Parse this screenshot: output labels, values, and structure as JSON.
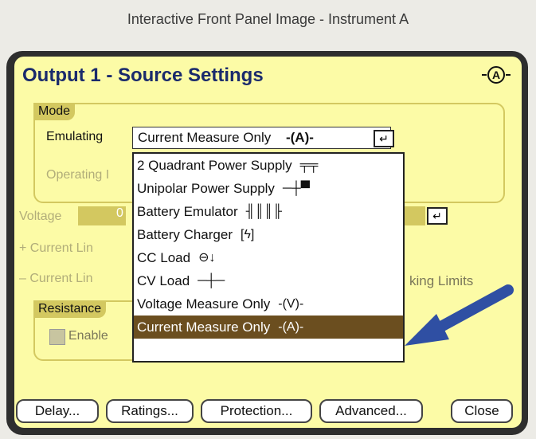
{
  "caption": "Interactive Front Panel Image - Instrument A",
  "panel": {
    "title": "Output 1 - Source Settings",
    "title_icon": "A"
  },
  "mode": {
    "group_label": "Mode",
    "emulating_label": "Emulating",
    "selected_value": "Current Measure Only",
    "selected_icon": "current-measure-icon",
    "operating_label": "Operating I"
  },
  "dropdown": {
    "options": [
      {
        "label": "2 Quadrant Power Supply",
        "icon": "two-quadrant-icon"
      },
      {
        "label": "Unipolar Power Supply",
        "icon": "unipolar-icon"
      },
      {
        "label": "Battery Emulator",
        "icon": "battery-emulator-icon"
      },
      {
        "label": "Battery Charger",
        "icon": "battery-charger-icon"
      },
      {
        "label": "CC Load",
        "icon": "cc-load-icon"
      },
      {
        "label": "CV Load",
        "icon": "cv-load-icon"
      },
      {
        "label": "Voltage Measure Only",
        "icon": "voltage-measure-icon"
      },
      {
        "label": "Current Measure Only",
        "icon": "current-measure-icon",
        "selected": true
      }
    ]
  },
  "fields": {
    "voltage_label": "Voltage",
    "voltage_value": "0",
    "plus_current_label": "+ Current Lin",
    "minus_current_label": "– Current Lin",
    "tracking_text": "king Limits"
  },
  "resistance": {
    "group_label": "Resistance",
    "enable_label": "Enable"
  },
  "buttons": {
    "delay": "Delay...",
    "ratings": "Ratings...",
    "protection": "Protection...",
    "advanced": "Advanced...",
    "close": "Close"
  },
  "colors": {
    "panel_bg": "#fcfba6",
    "title": "#1a2a6c",
    "group_border": "#d3c860",
    "selected_bg": "#6b4e1f",
    "arrow": "#2f4fa3"
  }
}
